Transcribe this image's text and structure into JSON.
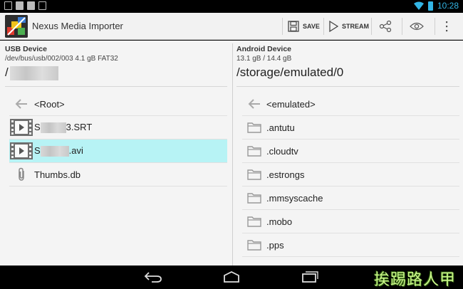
{
  "status_bar": {
    "time": "10:28"
  },
  "app": {
    "title": "Nexus Media Importer"
  },
  "toolbar": {
    "save_label": "SAVE",
    "stream_label": "STREAM"
  },
  "usb": {
    "title": "USB Device",
    "info": "/dev/bus/usb/002/003 4.1 gB FAT32",
    "path": "/",
    "items": [
      {
        "label": "<Root>",
        "icon": "back-arrow-icon"
      },
      {
        "prefix": "S",
        "suffix": "3.SRT",
        "icon": "video-file-icon"
      },
      {
        "prefix": "S",
        "suffix": ".avi",
        "icon": "video-file-icon",
        "selected": true
      },
      {
        "label": "Thumbs.db",
        "icon": "paperclip-icon"
      }
    ]
  },
  "android": {
    "title": "Android Device",
    "info": "13.1 gB / 14.4 gB",
    "path": "/storage/emulated/0",
    "items": [
      {
        "label": "<emulated>",
        "icon": "back-arrow-icon"
      },
      {
        "label": ".antutu",
        "icon": "folder-icon"
      },
      {
        "label": ".cloudtv",
        "icon": "folder-icon"
      },
      {
        "label": ".estrongs",
        "icon": "folder-icon"
      },
      {
        "label": ".mmsyscache",
        "icon": "folder-icon"
      },
      {
        "label": ".mobo",
        "icon": "folder-icon"
      },
      {
        "label": ".pps",
        "icon": "folder-icon"
      }
    ]
  },
  "watermark": "挨踢路人甲",
  "colors": {
    "accent": "#33b5e5",
    "selection": "#b7f3f5",
    "watermark": "#c9f58a"
  }
}
